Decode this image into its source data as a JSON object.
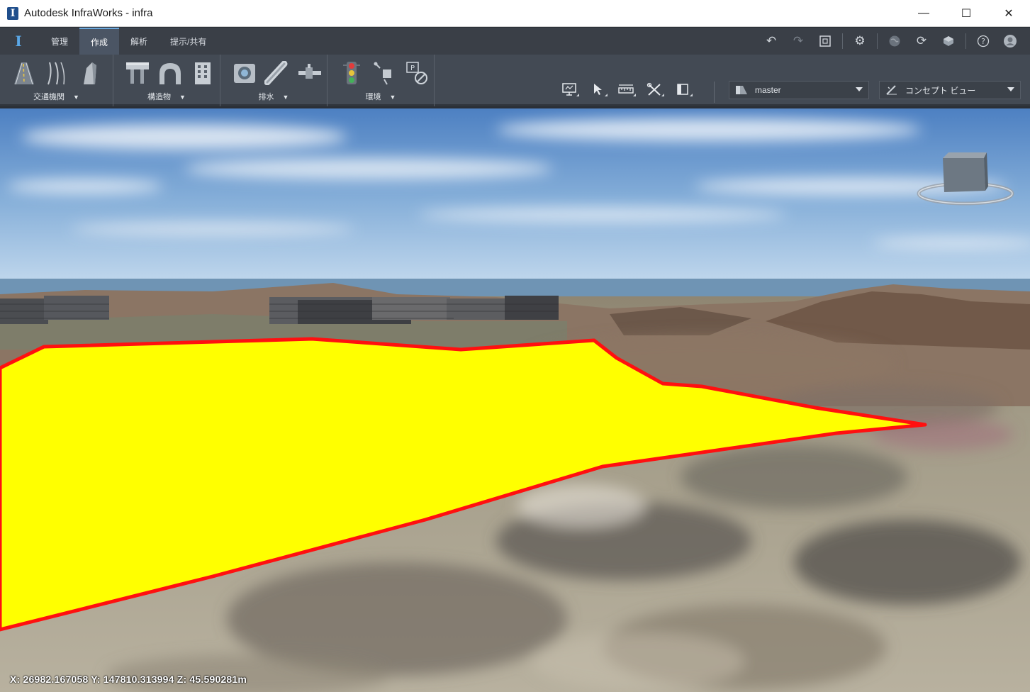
{
  "window": {
    "title": "Autodesk InfraWorks - infra",
    "app_icon": "I",
    "minimize": "—",
    "maximize": "☐",
    "close": "✕"
  },
  "tabs": [
    {
      "label": "管理",
      "active": false
    },
    {
      "label": "作成",
      "active": true
    },
    {
      "label": "解析",
      "active": false
    },
    {
      "label": "提示/共有",
      "active": false
    }
  ],
  "quick_tools": [
    "undo-icon",
    "redo-icon",
    "fit-view-icon",
    "settings-icon",
    "globe-icon",
    "sync-icon",
    "model-icon",
    "help-icon",
    "user-icon"
  ],
  "ribbon": {
    "groups": [
      {
        "label": "交通機関",
        "icons": [
          "road-icon",
          "rail-icon",
          "curb-icon"
        ]
      },
      {
        "label": "構造物",
        "icons": [
          "bridge-icon",
          "tunnel-icon",
          "building-icon"
        ]
      },
      {
        "label": "排水",
        "icons": [
          "drain-icon",
          "pipe-icon",
          "pipe-connector-icon"
        ]
      },
      {
        "label": "環境",
        "icons": [
          "traffic-light-icon",
          "tree-icon",
          "parking-icon"
        ]
      }
    ],
    "view_tools": [
      "presentation-icon",
      "select-icon",
      "measure-icon",
      "tools-icon",
      "panel-icon"
    ],
    "proposal": {
      "value": "master"
    },
    "view_style": {
      "value": "コンセプト ビュー"
    }
  },
  "viewport": {
    "coordinates": "X: 26982.167058 Y: 147810.313994 Z: 45.590281m",
    "polygon_fill": "#ffff00",
    "polygon_stroke": "#ff1010"
  }
}
